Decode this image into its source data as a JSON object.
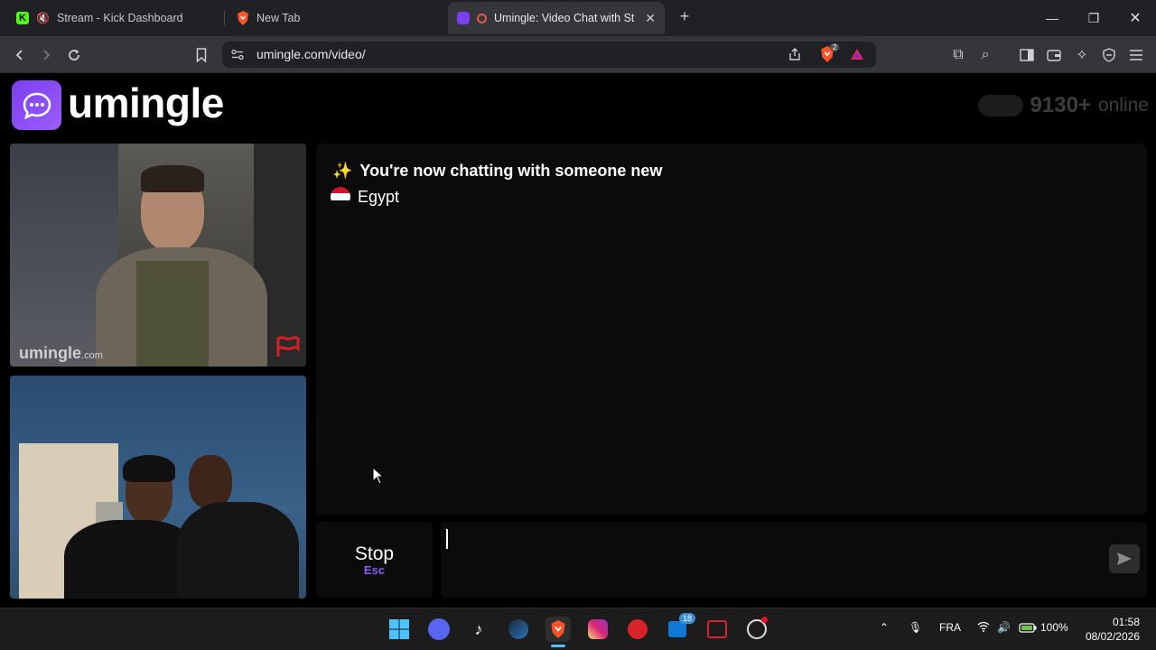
{
  "browser": {
    "tabs": [
      {
        "label": "Stream - Kick Dashboard",
        "favicon": "kick-icon",
        "muted": true
      },
      {
        "label": "New Tab",
        "favicon": "brave-icon"
      },
      {
        "label": "Umingle: Video Chat with Stra",
        "favicon": "umingle-icon",
        "recording": true,
        "active": true
      }
    ],
    "url": "umingle.com/video/",
    "brave_badge": "2"
  },
  "site": {
    "logo_text": "umingle",
    "online_count": "9130+",
    "online_label": "online",
    "video_watermark": "umingle",
    "video_watermark_suffix": ".com"
  },
  "chat": {
    "intro_emoji": "✨",
    "intro_message": "You're now chatting with someone new",
    "country": "Egypt"
  },
  "controls": {
    "stop_label": "Stop",
    "stop_key": "Esc",
    "input_value": ""
  },
  "taskbar": {
    "notification_badge": "18",
    "language": "FRA",
    "battery": "100%",
    "time": "01:58",
    "date": "08/02/2026"
  },
  "colors": {
    "accent": "#8b5cf6",
    "kick_green": "#53fc18",
    "brave_orange": "#fb542b"
  }
}
